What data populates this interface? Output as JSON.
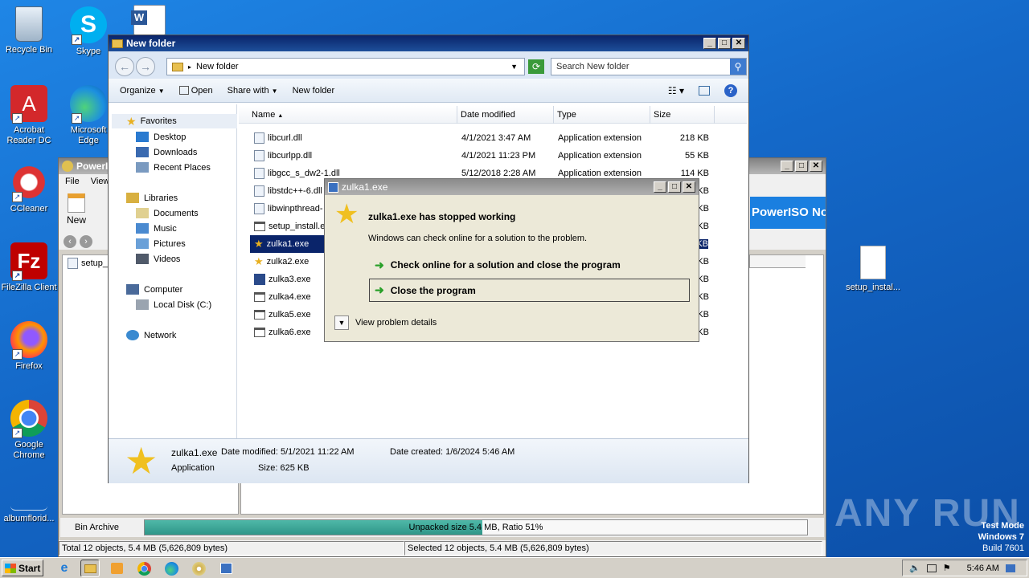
{
  "desktop": {
    "icons": [
      {
        "label": "Recycle Bin"
      },
      {
        "label": "Skype"
      },
      {
        "label": "Acrobat Reader DC"
      },
      {
        "label": "Microsoft Edge"
      },
      {
        "label": "CCleaner"
      },
      {
        "label": "FileZilla Client"
      },
      {
        "label": "Firefox"
      },
      {
        "label": "Google Chrome"
      },
      {
        "label": "albumflorid..."
      },
      {
        "label": "setup_instal..."
      }
    ],
    "watermark": "ANY RUN",
    "test_mode": [
      "Test Mode",
      "Windows 7",
      "Build 7601"
    ]
  },
  "poweriso": {
    "title": "PowerI",
    "menu": [
      "File",
      "View"
    ],
    "toolbar_new": "New",
    "banner": "PowerISO No",
    "list_item": "setup_",
    "bin_archive": "Bin Archive",
    "progress_text": "Unpacked size 5.4 MB, Ratio 51%",
    "progress": 0.51,
    "status_left": "Total 12 objects, 5.4 MB (5,626,809 bytes)",
    "status_right": "Selected 12 objects, 5.4 MB (5,626,809 bytes)"
  },
  "explorer": {
    "title": "New folder",
    "address": "New folder",
    "search_placeholder": "Search New folder",
    "toolbar": {
      "organize": "Organize",
      "open": "Open",
      "share_with": "Share with",
      "new_folder": "New folder"
    },
    "columns": {
      "name": "Name",
      "date": "Date modified",
      "type": "Type",
      "size": "Size"
    },
    "nav": {
      "favorites": "Favorites",
      "desktop": "Desktop",
      "downloads": "Downloads",
      "recent": "Recent Places",
      "libraries": "Libraries",
      "documents": "Documents",
      "music": "Music",
      "pictures": "Pictures",
      "videos": "Videos",
      "computer": "Computer",
      "local_disk": "Local Disk (C:)",
      "network": "Network"
    },
    "files": [
      {
        "name": "libcurl.dll",
        "date": "4/1/2021 3:47 AM",
        "type": "Application extension",
        "size": "218 KB"
      },
      {
        "name": "libcurlpp.dll",
        "date": "4/1/2021 11:23 PM",
        "type": "Application extension",
        "size": "55 KB"
      },
      {
        "name": "libgcc_s_dw2-1.dll",
        "date": "5/12/2018 2:28 AM",
        "type": "Application extension",
        "size": "114 KB"
      },
      {
        "name": "libstdc++-6.dll",
        "date": "",
        "type": "",
        "size": "KB"
      },
      {
        "name": "libwinpthread-",
        "date": "",
        "type": "",
        "size": "KB"
      },
      {
        "name": "setup_install.e",
        "date": "",
        "type": "",
        "size": "KB"
      },
      {
        "name": "zulka1.exe",
        "date": "",
        "type": "",
        "size": "KB"
      },
      {
        "name": "zulka2.exe",
        "date": "",
        "type": "",
        "size": "KB"
      },
      {
        "name": "zulka3.exe",
        "date": "",
        "type": "",
        "size": "KB"
      },
      {
        "name": "zulka4.exe",
        "date": "",
        "type": "",
        "size": "KB"
      },
      {
        "name": "zulka5.exe",
        "date": "",
        "type": "",
        "size": "KB"
      },
      {
        "name": "zulka6.exe",
        "date": "",
        "type": "",
        "size": "KB"
      }
    ],
    "details": {
      "name": "zulka1.exe",
      "date_modified": "Date modified: 5/1/2021 11:22 AM",
      "date_created": "Date created: 1/6/2024 5:46 AM",
      "type": "Application",
      "size": "Size: 625 KB"
    }
  },
  "dialog": {
    "title": "zulka1.exe",
    "heading": "zulka1.exe has stopped working",
    "message": "Windows can check online for a solution to the problem.",
    "option1": "Check online for a solution and close the program",
    "option2": "Close the program",
    "details": "View problem details"
  },
  "taskbar": {
    "start": "Start",
    "time": "5:46 AM"
  }
}
